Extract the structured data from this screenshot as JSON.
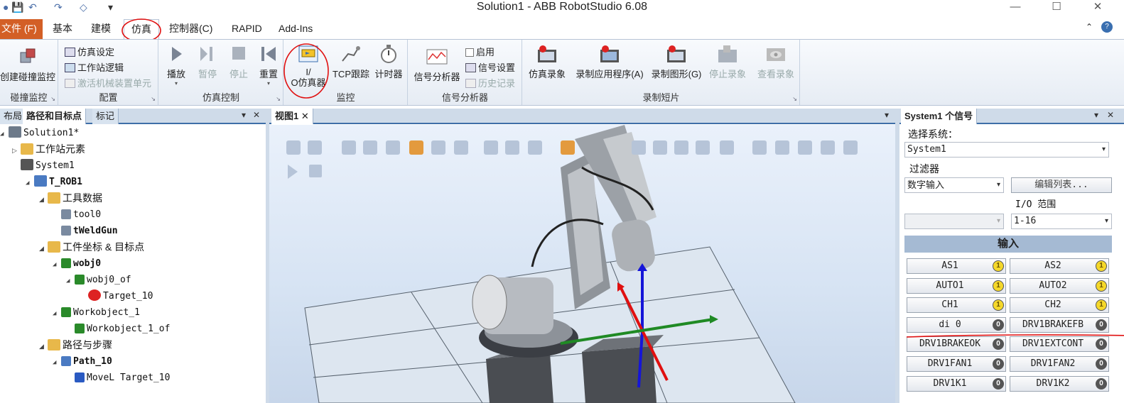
{
  "window": {
    "title": "Solution1 - ABB RobotStudio 6.08",
    "controls": {
      "minimize": "—",
      "maximize": "☐",
      "close": "✕"
    }
  },
  "quick_access": {
    "save": "💾",
    "undo": "↶",
    "redo": "↷",
    "more": "▾"
  },
  "tabs": [
    {
      "label": "文件 (F)",
      "id": "file"
    },
    {
      "label": "基本"
    },
    {
      "label": "建模"
    },
    {
      "label": "仿真",
      "selected": true
    },
    {
      "label": "控制器(C)"
    },
    {
      "label": "RAPID"
    },
    {
      "label": "Add-Ins"
    }
  ],
  "ribbon": {
    "collision": {
      "button": "创建碰撞监控",
      "label": "碰撞监控"
    },
    "config": {
      "items": [
        "仿真设定",
        "工作站逻辑",
        "激活机械装置单元"
      ],
      "label": "配置"
    },
    "sim_control": {
      "buttons": [
        "播放",
        "暂停",
        "停止",
        "重置"
      ],
      "label": "仿真控制"
    },
    "monitor": {
      "io_sim_line1": "I/",
      "io_sim_line2": "O仿真器",
      "tcp": "TCP跟踪",
      "timer": "计时器",
      "label": "监控"
    },
    "signal_analyzer": {
      "button": "信号分析器",
      "enable": "启用",
      "settings": "信号设置",
      "history": "历史记录",
      "label": "信号分析器"
    },
    "recording": {
      "buttons": [
        "仿真录象",
        "录制应用程序(A)",
        "录制图形(G)",
        "停止录象",
        "查看录象"
      ],
      "label": "录制短片"
    }
  },
  "left_panel": {
    "tabs": [
      "布局",
      "路径和目标点",
      "标记"
    ],
    "tree": [
      {
        "text": "Solution1*",
        "level": 0,
        "icon": "solution-icon"
      },
      {
        "text": "工作站元素",
        "level": 1,
        "icon": "folder-icon"
      },
      {
        "text": "System1",
        "level": 1,
        "icon": "controller-icon"
      },
      {
        "text": "T_ROB1",
        "level": 2,
        "icon": "task-icon",
        "bold": true
      },
      {
        "text": "工具数据",
        "level": 3,
        "icon": "tooldata-folder-icon"
      },
      {
        "text": "tool0",
        "level": 4,
        "icon": "tool-icon"
      },
      {
        "text": "tWeldGun",
        "level": 4,
        "icon": "tool-icon",
        "bold": true
      },
      {
        "text": "工件坐标 & 目标点",
        "level": 3,
        "icon": "wobj-folder-icon"
      },
      {
        "text": "wobj0",
        "level": 4,
        "icon": "frame-icon",
        "bold": true
      },
      {
        "text": "wobj0_of",
        "level": 5,
        "icon": "frame-icon"
      },
      {
        "text": "Target_10",
        "level": 6,
        "icon": "target-icon"
      },
      {
        "text": "Workobject_1",
        "level": 4,
        "icon": "frame-icon"
      },
      {
        "text": "Workobject_1_of",
        "level": 5,
        "icon": "frame-icon"
      },
      {
        "text": "路径与步骤",
        "level": 3,
        "icon": "path-folder-icon"
      },
      {
        "text": "Path_10",
        "level": 4,
        "icon": "path-icon",
        "bold": true
      },
      {
        "text": "MoveL Target_10",
        "level": 5,
        "icon": "movel-icon"
      }
    ]
  },
  "viewport": {
    "tab": "视图1"
  },
  "signals_panel": {
    "title": "System1 个信号",
    "select_system_label": "选择系统：",
    "system_value": "System1",
    "filter_label": "过滤器",
    "filter_value": "数字输入",
    "edit_list_button": "编辑列表...",
    "io_range_label": "I/O 范围",
    "io_range_value": "1-16",
    "input_header": "输入",
    "signals": [
      {
        "name": "AS1",
        "state": "1"
      },
      {
        "name": "AS2",
        "state": "1"
      },
      {
        "name": "AUTO1",
        "state": "1"
      },
      {
        "name": "AUTO2",
        "state": "1"
      },
      {
        "name": "CH1",
        "state": "1"
      },
      {
        "name": "CH2",
        "state": "1"
      },
      {
        "name": "di 0",
        "state": "0"
      },
      {
        "name": "DRV1BRAKEFB",
        "state": "0"
      },
      {
        "name": "DRV1BRAKEOK",
        "state": "0"
      },
      {
        "name": "DRV1EXTCONT",
        "state": "0"
      },
      {
        "name": "DRV1FAN1",
        "state": "0"
      },
      {
        "name": "DRV1FAN2",
        "state": "0"
      },
      {
        "name": "DRV1K1",
        "state": "0"
      },
      {
        "name": "DRV1K2",
        "state": "0"
      }
    ]
  }
}
